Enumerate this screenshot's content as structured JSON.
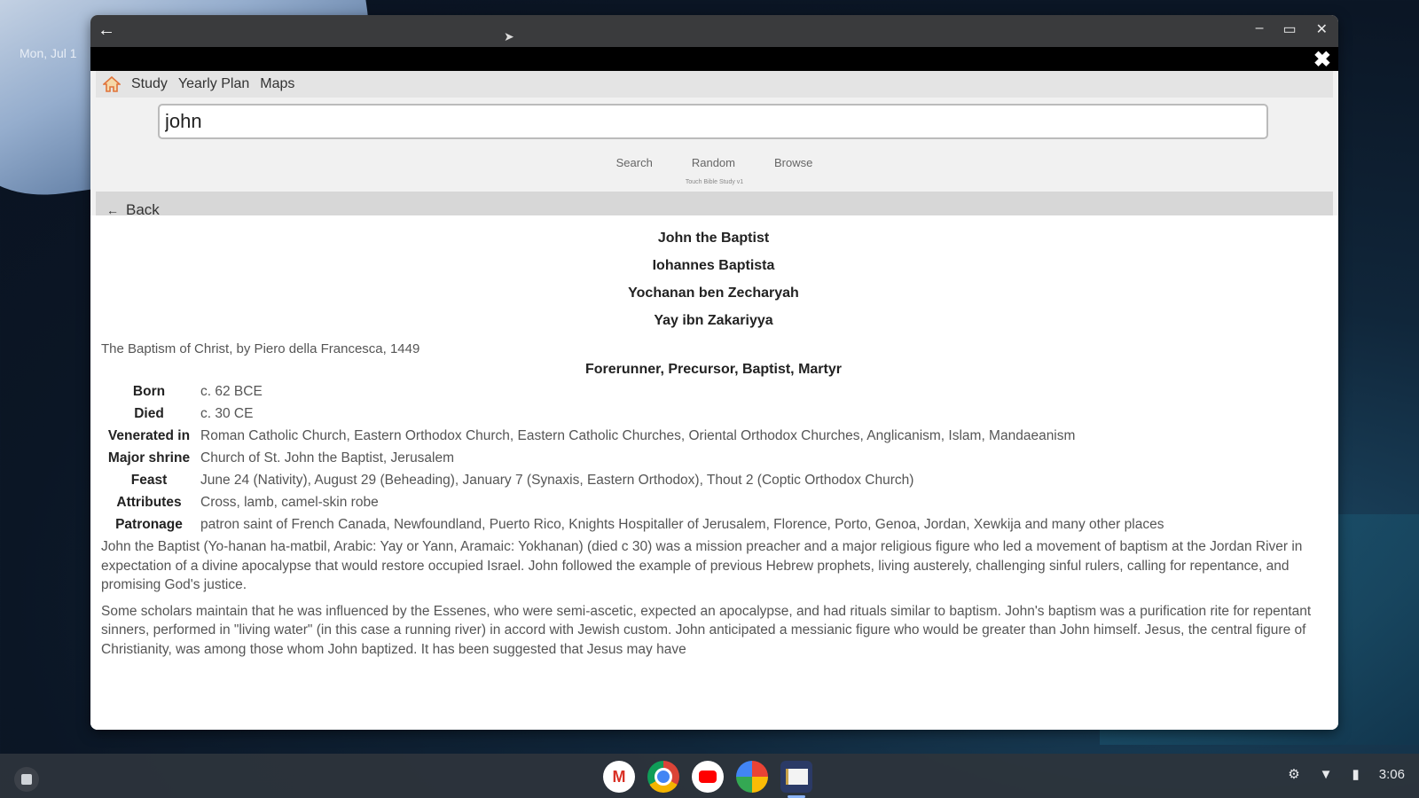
{
  "desktop": {
    "date_label": "Mon, Jul 1"
  },
  "window": {
    "controls": {
      "back": "←",
      "minimize": "–",
      "maximize": "▭",
      "close": "✕"
    },
    "close_x": "✖"
  },
  "menu": {
    "home_icon": "home-icon",
    "items": [
      "Study",
      "Yearly Plan",
      "Maps"
    ]
  },
  "search": {
    "value": "john",
    "buttons": [
      "Search",
      "Random",
      "Browse"
    ],
    "caption": "Touch Bible Study v1"
  },
  "back_bar": {
    "arrow": "←",
    "label": "Back"
  },
  "article": {
    "names": [
      "John the Baptist",
      "Iohannes Baptista",
      "Yochanan ben Zecharyah",
      "Yay ibn Zakariyya"
    ],
    "image_caption": "The Baptism of Christ, by Piero della Francesca, 1449",
    "titles": "Forerunner, Precursor, Baptist, Martyr",
    "infobox": [
      {
        "label": "Born",
        "value": "c. 62 BCE"
      },
      {
        "label": "Died",
        "value": "c. 30 CE"
      },
      {
        "label": "Venerated in",
        "value": "Roman Catholic Church, Eastern Orthodox Church, Eastern Catholic Churches, Oriental Orthodox Churches, Anglicanism, Islam, Mandaeanism"
      },
      {
        "label": "Major shrine",
        "value": "Church of St. John the Baptist, Jerusalem"
      },
      {
        "label": "Feast",
        "value": "June 24 (Nativity), August 29 (Beheading), January 7 (Synaxis, Eastern Orthodox), Thout 2 (Coptic Orthodox Church)"
      },
      {
        "label": "Attributes",
        "value": "Cross, lamb, camel-skin robe"
      },
      {
        "label": "Patronage",
        "value": "patron saint of French Canada, Newfoundland, Puerto Rico, Knights Hospitaller of Jerusalem, Florence, Porto, Genoa, Jordan, Xewkija and many other places"
      }
    ],
    "paragraphs": [
      "John the Baptist (Yo-hanan ha-matbil, Arabic: Yay or Yann, Aramaic: Yokhanan) (died c 30) was a mission preacher and a major religious figure who led a movement of baptism at the Jordan River in expectation of a divine apocalypse that would restore occupied Israel. John followed the example of previous Hebrew prophets, living austerely, challenging sinful rulers, calling for repentance, and promising God's justice.",
      "Some scholars maintain that he was influenced by the Essenes, who were semi-ascetic, expected an apocalypse, and had rituals similar to baptism. John's baptism was a purification rite for repentant sinners, performed in \"living water\" (in this case a running river) in accord with Jewish custom. John anticipated a messianic figure who would be greater than John himself. Jesus, the central figure of Christianity, was among those whom John baptized. It has been suggested that Jesus may have"
    ]
  },
  "taskbar": {
    "apps": [
      "gmail-icon",
      "chrome-icon",
      "youtube-icon",
      "photos-icon",
      "bible-app-icon"
    ],
    "gmail_letter": "M",
    "time": "3:06"
  }
}
